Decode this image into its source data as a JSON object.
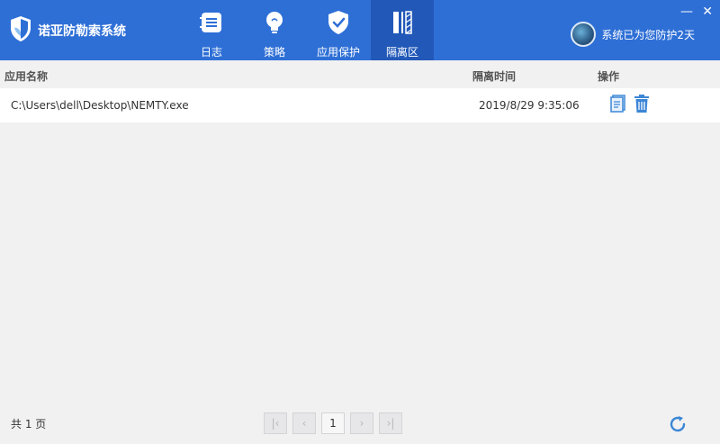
{
  "app": {
    "title": "诺亚防勒索系统"
  },
  "nav": {
    "items": [
      {
        "label": "日志",
        "icon": "log-icon"
      },
      {
        "label": "策略",
        "icon": "bulb-icon"
      },
      {
        "label": "应用保护",
        "icon": "shield-check-icon"
      },
      {
        "label": "隔离区",
        "icon": "quarantine-icon",
        "active": true
      }
    ]
  },
  "status": {
    "text": "系统已为您防护2天"
  },
  "window": {
    "minimize": "—",
    "close": "✕"
  },
  "table": {
    "headers": {
      "name": "应用名称",
      "time": "隔离时间",
      "op": "操作"
    },
    "rows": [
      {
        "name": "C:\\Users\\dell\\Desktop\\NEMTY.exe",
        "time": "2019/8/29 9:35:06"
      }
    ]
  },
  "footer": {
    "total": "共 1 页",
    "pagination": {
      "first": "|‹",
      "prev": "‹",
      "current": "1",
      "next": "›",
      "last": "›|"
    }
  },
  "colors": {
    "header": "#2e6fd6",
    "active_tab": "#2259b8",
    "icon_blue": "#3b86d6"
  }
}
